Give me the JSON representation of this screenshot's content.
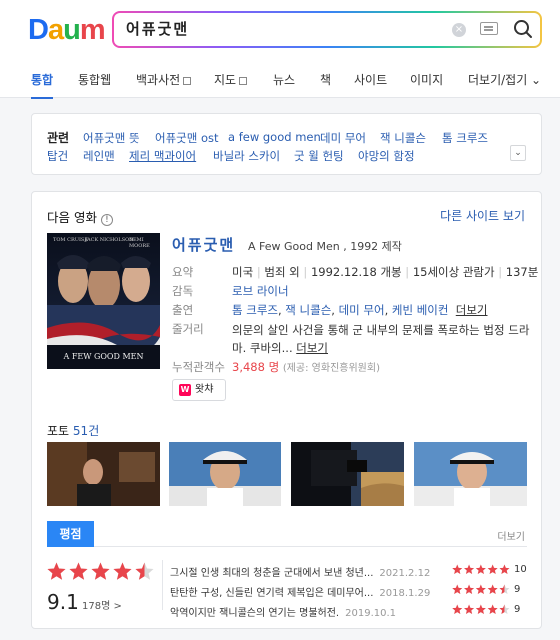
{
  "header": {
    "logo": [
      "D",
      "a",
      "u",
      "m"
    ],
    "query": "어퓨굿맨",
    "clear_glyph": "×"
  },
  "tabs": [
    {
      "label": "통합",
      "active": true
    },
    {
      "label": "통합웹"
    },
    {
      "label": "백과사전",
      "checkbox": true
    },
    {
      "label": "지도",
      "checkbox": true
    },
    {
      "label": "뉴스"
    },
    {
      "label": "책"
    },
    {
      "label": "사이트"
    },
    {
      "label": "이미지"
    },
    {
      "label": "더보기/접기 ⌄"
    }
  ],
  "related": {
    "title": "관련",
    "row1": [
      "어퓨굿맨 뜻",
      "어퓨굿맨 ost",
      "a few good men",
      "데미 무어",
      "잭 니콜슨",
      "톰 크루즈"
    ],
    "row2": [
      "탑건",
      "레인맨",
      "제리 맥과이어",
      "바닐라 스카이",
      "굿 윌 헌팅",
      "야망의 함정"
    ],
    "expand_glyph": "⌄"
  },
  "movie": {
    "section_title": "다음 영화",
    "info_glyph": "!",
    "other_site": "다른 사이트 보기",
    "title": "어퓨굿맨",
    "subtitle": "A Few Good Men , 1992 제작",
    "poster": {
      "cast": [
        "TOM CRUISE",
        "JACK NICHOLSON",
        "DEMI MOORE"
      ],
      "title": "A FEW GOOD MEN"
    },
    "overview_label": "요약",
    "overview": [
      "미국",
      "범죄 외",
      "1992.12.18 개봉",
      "15세이상 관람가",
      "137분"
    ],
    "director_label": "감독",
    "director": "로브 라이너",
    "cast_label": "출연",
    "cast": [
      "톰 크루즈",
      "잭 니콜슨",
      "데미 무어",
      "케빈 베이컨"
    ],
    "cast_more": "더보기",
    "plot_label": "줄거리",
    "plot": "의문의 살인 사건을 통해 군 내부의 문제를 폭로하는 법정 드라마. 쿠바의...",
    "plot_more": "더보기",
    "audience_label": "누적관객수",
    "audience": "3,488 명",
    "audience_note": "(제공: 영화진흥위원회)",
    "watcha": "왓챠",
    "watcha_glyph": "W"
  },
  "photos": {
    "label": "포토",
    "count": "51건"
  },
  "rating": {
    "tab": "평점",
    "more": "더보기",
    "score": "9.1",
    "stars": 4.5,
    "count": "178명 >",
    "reviews": [
      {
        "text": "그시절 인생 최대의 청춘을 군대에서 보낸 청년...",
        "date": "2021.2.12",
        "stars": 5,
        "score": "10"
      },
      {
        "text": "탄탄한 구성, 신들린 연기력 제복입은 데미무어...",
        "date": "2018.1.29",
        "stars": 4.5,
        "score": "9"
      },
      {
        "text": "악역이지만 잭니콜슨의 연기는 명불허전.",
        "date": "2019.10.1",
        "stars": 4.5,
        "score": "9"
      }
    ]
  },
  "colors": {
    "link": "#2a5db0",
    "accent": "#2a86f5",
    "star": "#e8454b",
    "red": "#e8454b"
  }
}
